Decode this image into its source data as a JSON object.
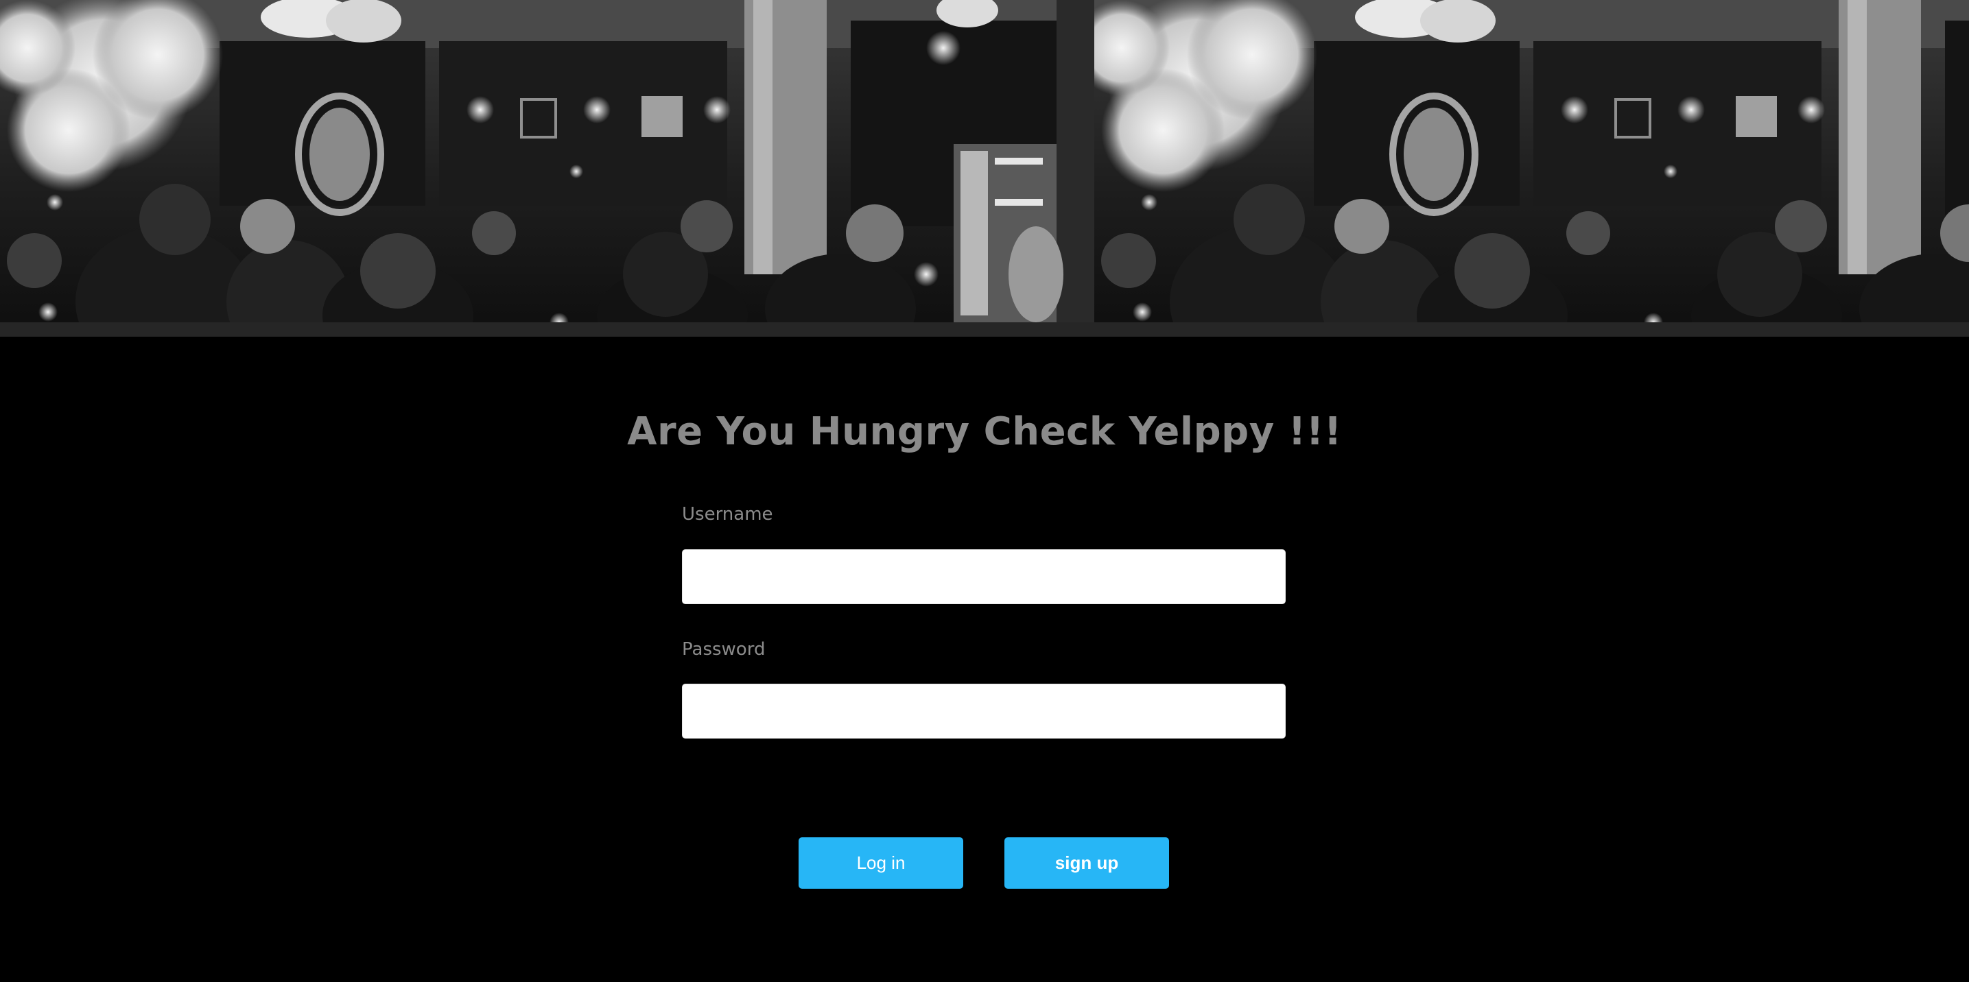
{
  "banner": {
    "description_icon": "restaurant-photo",
    "tiles": 2
  },
  "login": {
    "heading": "Are You Hungry Check Yelppy !!!",
    "username_label": "Username",
    "username_value": "",
    "password_label": "Password",
    "password_value": "",
    "login_button": "Log in",
    "signup_button": "sign up"
  },
  "colors": {
    "background": "#000000",
    "heading": "#8a8a8a",
    "label": "#8c8c8c",
    "button": "#27b6f6",
    "button_text": "#ffffff"
  }
}
